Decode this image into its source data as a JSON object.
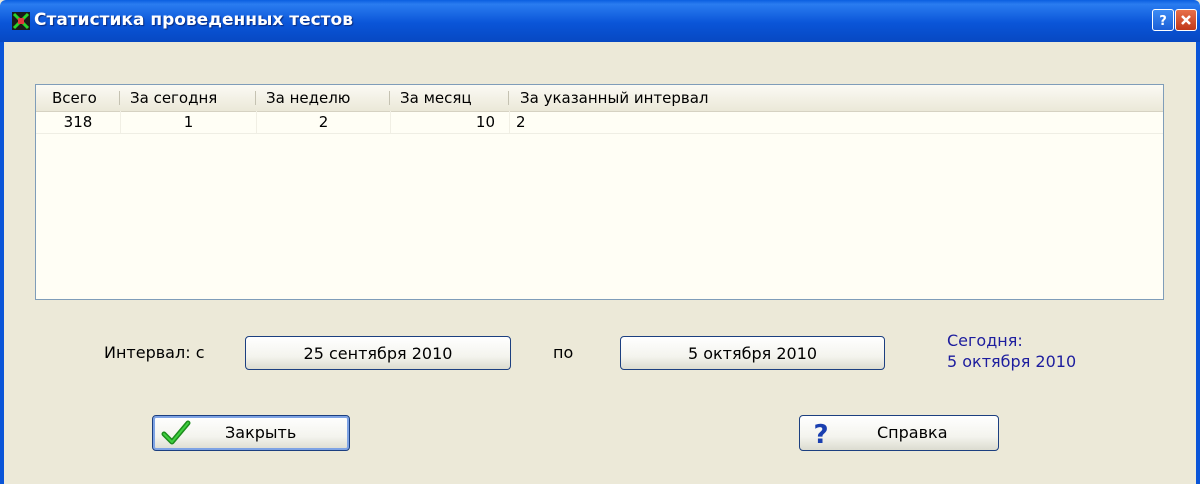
{
  "window": {
    "title": "Статистика проведенных тестов"
  },
  "table": {
    "columns": [
      "Всего",
      "За сегодня",
      "За неделю",
      "За месяц",
      "За указанный интервал"
    ],
    "rows": [
      [
        "318",
        "1",
        "2",
        "10",
        "2"
      ]
    ]
  },
  "interval": {
    "label": "Интервал: с",
    "from": "25 сентября 2010",
    "to_label": "по",
    "to": "5 октября 2010"
  },
  "today": {
    "label": "Сегодня:",
    "date": "5 октября 2010"
  },
  "buttons": {
    "close": "Закрыть",
    "help": "Справка"
  },
  "icons": {
    "title": "app-icon",
    "close": "checkmark-icon",
    "help": "question-mark-icon"
  }
}
